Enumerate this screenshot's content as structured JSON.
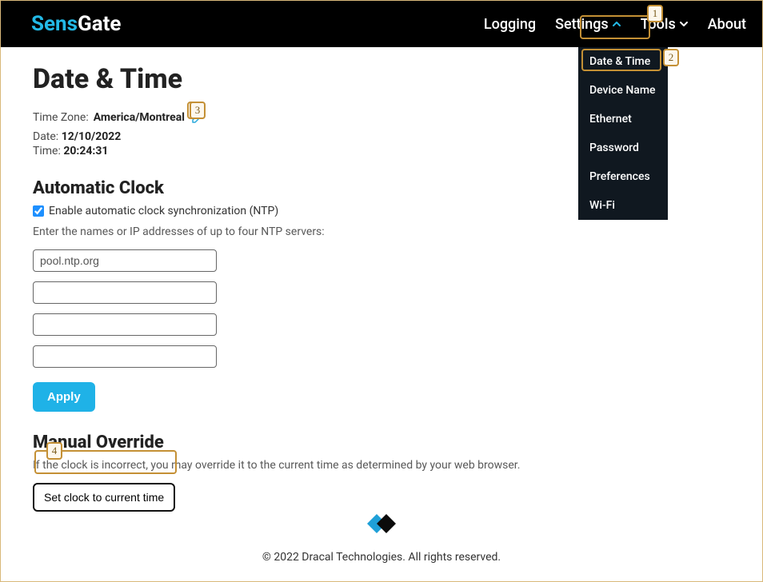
{
  "brand": {
    "accent": "Sens",
    "rest": "Gate"
  },
  "nav": {
    "logging": "Logging",
    "settings": "Settings",
    "tools": "Tools",
    "about": "About"
  },
  "dropdown": {
    "items": [
      "Date & Time",
      "Device Name",
      "Ethernet",
      "Password",
      "Preferences",
      "Wi-Fi"
    ]
  },
  "page": {
    "title": "Date & Time",
    "tz_label": "Time Zone:",
    "tz_value": "America/Montreal",
    "date_label": "Date:",
    "date_value": "12/10/2022",
    "time_label": "Time:",
    "time_value": "20:24:31"
  },
  "auto": {
    "heading": "Automatic Clock",
    "checkbox_label": "Enable automatic clock synchronization (NTP)",
    "hint": "Enter the names or IP addresses of up to four NTP servers:",
    "servers": [
      "pool.ntp.org",
      "",
      "",
      ""
    ],
    "apply": "Apply"
  },
  "manual": {
    "heading": "Manual Override",
    "hint": "If the clock is incorrect, you may override it to the current time as determined by your web browser.",
    "button": "Set clock to current time"
  },
  "footer": "© 2022 Dracal Technologies. All rights reserved.",
  "markers": [
    "1",
    "2",
    "3",
    "4"
  ]
}
